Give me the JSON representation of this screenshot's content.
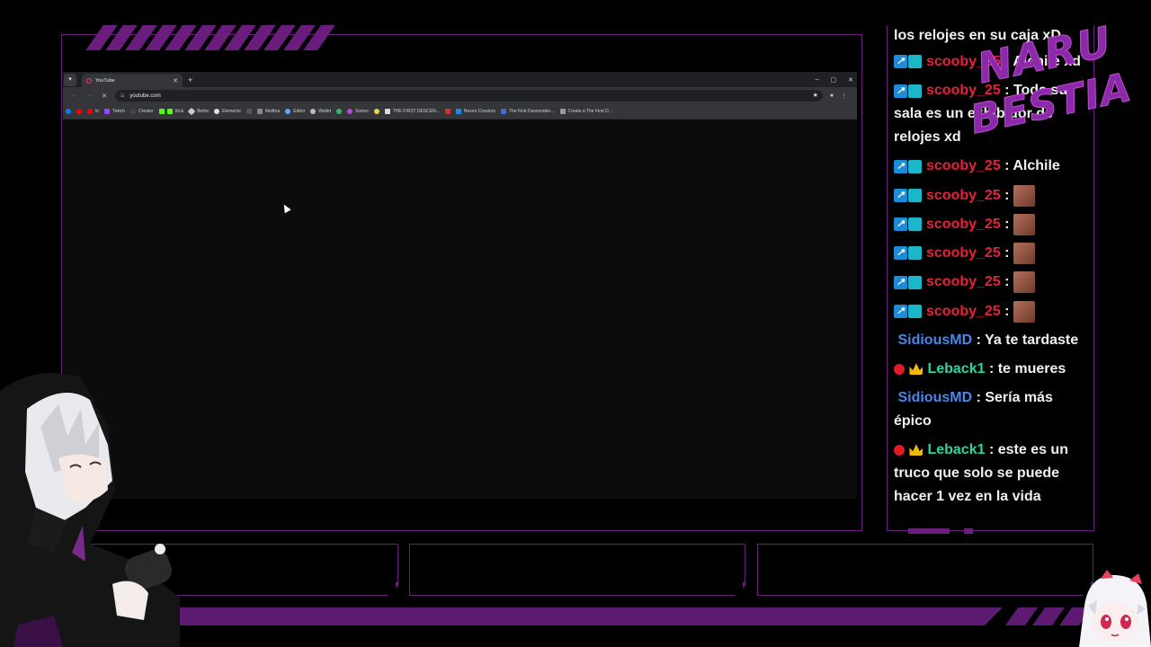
{
  "browser": {
    "tab": {
      "title": "YouTube"
    },
    "address": "youtube.com",
    "bookmarks": [
      "lo",
      "Twitch",
      "Creator",
      "Kick",
      "Botrix",
      "Elements",
      "Mailbra",
      "Editor",
      "Wallet",
      "Sorteo",
      "THE FIRST DESCEN...",
      "Nexon Creators",
      "The First Descenden...",
      "Create a The First D..."
    ],
    "controls": {
      "minimize": "–",
      "restore": "▢",
      "close": "✕",
      "new_tab": "+",
      "tab_close": "✕"
    }
  },
  "logo": {
    "line1": "NARU",
    "line2": "BESTIA"
  },
  "chat": {
    "messages": [
      {
        "user": "",
        "text": "los relojes en su caja xD",
        "badges": []
      },
      {
        "user": "scooby_25",
        "text": "Alchile xd",
        "badges": [
          "prime",
          "sub"
        ],
        "color": "red"
      },
      {
        "user": "scooby_25",
        "text": "Toda su sala es un exhibidor de relojes xd",
        "badges": [
          "prime",
          "sub"
        ],
        "color": "red"
      },
      {
        "user": "scooby_25",
        "text": "Alchile",
        "badges": [
          "prime",
          "sub"
        ],
        "color": "red"
      },
      {
        "user": "scooby_25",
        "text": "",
        "emote": true,
        "badges": [
          "prime",
          "sub"
        ],
        "color": "red"
      },
      {
        "user": "scooby_25",
        "text": "",
        "emote": true,
        "badges": [
          "prime",
          "sub"
        ],
        "color": "red"
      },
      {
        "user": "scooby_25",
        "text": "",
        "emote": true,
        "badges": [
          "prime",
          "sub"
        ],
        "color": "red"
      },
      {
        "user": "scooby_25",
        "text": "",
        "emote": true,
        "badges": [
          "prime",
          "sub"
        ],
        "color": "red"
      },
      {
        "user": "scooby_25",
        "text": "",
        "emote": true,
        "badges": [
          "prime",
          "sub"
        ],
        "color": "red"
      },
      {
        "user": "SidiousMD",
        "text": "Ya te tardaste",
        "badges": [],
        "color": "blue"
      },
      {
        "user": "Leback1",
        "text": "te mueres",
        "badges": [
          "red",
          "crown"
        ],
        "color": "green"
      },
      {
        "user": "SidiousMD",
        "text": "Sería más épico",
        "badges": [],
        "color": "blue"
      },
      {
        "user": "Leback1",
        "text": "este es un truco que solo se puede hacer 1 vez en la vida",
        "badges": [
          "red",
          "crown"
        ],
        "color": "green"
      }
    ]
  },
  "colors": {
    "accent": "#6b1f7d",
    "chat_red": "#e2233a",
    "chat_blue": "#4a86e8",
    "chat_green": "#2bd5a0"
  }
}
